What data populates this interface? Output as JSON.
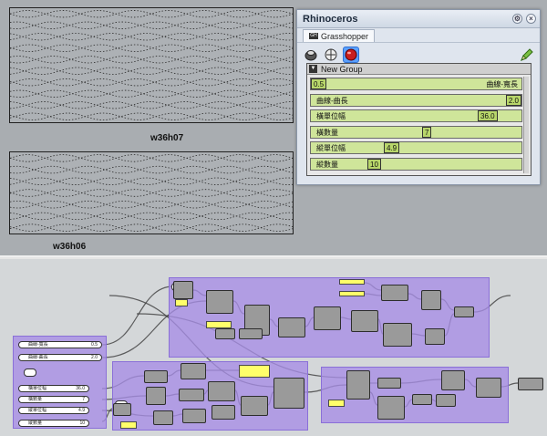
{
  "viewport": {
    "top_label": "w36h07",
    "bottom_label": "w36h06"
  },
  "rhino": {
    "title": "Rhinoceros",
    "tab_label": "Grasshopper",
    "tab_badge": "GH",
    "group_title": "New Group",
    "sliders": [
      {
        "label": "曲線-寬長",
        "value": "0.5",
        "value_side": "left"
      },
      {
        "label": "曲線-曲長",
        "value": "2.0",
        "value_side": "right"
      },
      {
        "label": "橫單位幅",
        "value": "36.0",
        "value_side": "right"
      },
      {
        "label": "橫數量",
        "value": "7",
        "value_side": "right"
      },
      {
        "label": "縱單位幅",
        "value": "4.9",
        "value_side": "right"
      },
      {
        "label": "縱數量",
        "value": "10",
        "value_side": "right"
      }
    ],
    "slider_fill": [
      0.0,
      1.0,
      0.83,
      0.55,
      0.36,
      0.28
    ],
    "colors": {
      "slider_bg": "#cfe59a",
      "slider_val": "#b8d66a",
      "group_purple": "#a68de6",
      "param_yellow": "#ffff6a"
    }
  },
  "canvas": {
    "side_sliders": [
      {
        "label": "曲線-寬長",
        "value": "0.5"
      },
      {
        "label": "曲線-曲長",
        "value": "2.0"
      },
      {
        "label": "橫單位幅",
        "value": "36.0"
      },
      {
        "label": "橫數量",
        "value": "7"
      },
      {
        "label": "縱單位幅",
        "value": "4.9"
      },
      {
        "label": "縱數量",
        "value": "10"
      }
    ],
    "icons": [
      "rhino-preview-icon",
      "wire-display-icon",
      "render-preview-icon",
      "pencil-icon"
    ]
  }
}
